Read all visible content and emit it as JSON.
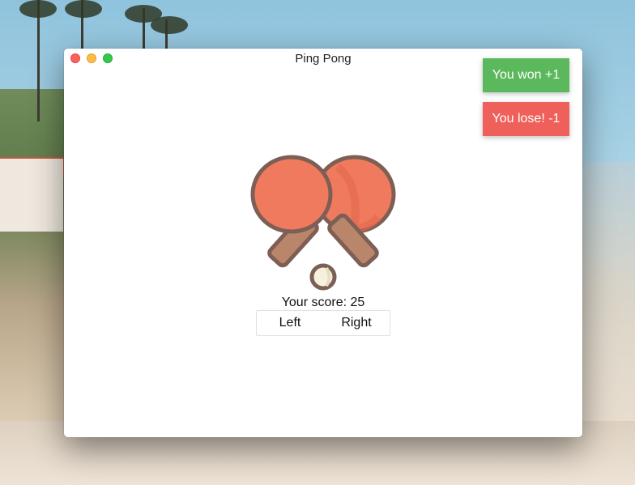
{
  "window": {
    "title": "Ping Pong"
  },
  "game": {
    "score_label": "Your score: 25",
    "left_label": "Left",
    "right_label": "Right"
  },
  "notifications": {
    "won": "You won +1",
    "lose": "You lose! -1"
  },
  "colors": {
    "won_bg": "#5cb85c",
    "lose_bg": "#f0605a",
    "paddle": "#f07a5e",
    "handle": "#b9866b",
    "outline": "#7d5f55",
    "ball": "#f6f1de"
  },
  "icons": {
    "logo": "ping-pong-paddles-icon"
  }
}
